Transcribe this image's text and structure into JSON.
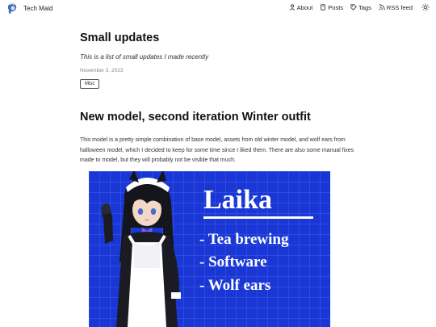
{
  "header": {
    "brand_name": "Tech Maid",
    "nav": [
      {
        "label": "About",
        "icon": "user-icon"
      },
      {
        "label": "Posts",
        "icon": "book-icon"
      },
      {
        "label": "Tags",
        "icon": "tag-icon"
      },
      {
        "label": "RSS feed",
        "icon": "rss-icon"
      }
    ],
    "theme_icon": "sun-icon"
  },
  "post": {
    "title": "Small updates",
    "description": "This is a list of small updates I made recently",
    "date": "November 3, 2023",
    "tag": "Misc"
  },
  "section": {
    "heading": "New model, second iteration Winter outfit",
    "body": "This model is a pretty simple combination of base model, assets from old winter model, and wolf ears from halloween model, which I decided to keep for some time since I liked them. There are also some manual fixes made to model, but they will probably not be visible that much."
  },
  "image": {
    "title": "Laika",
    "lines": [
      "- Tea brewing",
      "- Software",
      "- Wolf ears"
    ],
    "background_color": "#1a37d6"
  }
}
